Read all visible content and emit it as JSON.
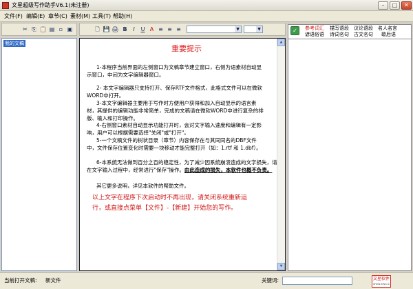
{
  "window": {
    "title": "文星超级写作助手V6.1(未注册)",
    "controls": {
      "minimize": "–",
      "maximize": "□",
      "close": "✕"
    }
  },
  "menu": [
    "文件(F)",
    "编辑(E)",
    "章节(C)",
    "素材(M)",
    "工具(T)",
    "帮助(H)"
  ],
  "icons": {
    "tree_toolbar": [
      "cut-icon",
      "copy-icon",
      "paste-icon",
      "list-icon",
      "page-icon",
      "pages-icon"
    ],
    "editor_toolbar": [
      "new-file-icon",
      "save-icon",
      "print-icon",
      "bold-icon",
      "italic-icon",
      "underline-icon",
      "font-color-icon",
      "align-left-icon",
      "align-center-icon",
      "align-right-icon"
    ],
    "glyphs": [
      "✂",
      "⎘",
      "📋",
      "▤",
      "▫",
      "▣",
      "🗋",
      "💾",
      "🖨",
      "B",
      "I",
      "U",
      "A",
      "≡",
      "≡",
      "≡"
    ]
  },
  "tree": {
    "item": "我的文稿"
  },
  "editor": {
    "title": "重要提示",
    "p1": "1-本程序当前界面的左侧窗口为文稿章节建立窗口，右侧为语素材自动显示窗口，中间为文字编辑器窗口。",
    "p2": "2- 本文字编辑器只支持打开、保存RTF文件格式，此格式文件可以在微软WORD中打开。",
    "p3": "3-本文字编辑器主要用于写作时方便用户获得和加入自动显示的语言素材，其提供的编辑功能非常简单，完成的文稿请在微软WORD中进行复杂的排版、输入和打印操作。",
    "p4": "4-右侧窗口素材自动显示功能打开时，会对文字输入速度和编辑有一定影响，用户可以根据需要选择\"关闭\"或\"打开\"。",
    "p5": "5-一个文稿文件的树状目录（章节）内容保存在与其同同名的DBF文件中，文件保存位置变化时需要一块移动才能完整打开（如：1.rtf 和 1.dbf）。",
    "p6_a": "6-本系统无法做到百分之百的稳定性，为了减少因系统崩溃造成的文字损失，请在文字输入过程中，经常进行\"保存\"操作。",
    "p6_b": "由此造成的损失，本软件也概不负责。",
    "p7": "其它更多说明，详见本软件的帮助文件。",
    "note": "以上文字在程序下次启动时不再出现，请关闭系统重新运行，或直接点菜单【文件】-【新建】开始您的写作。"
  },
  "scrollbar": {
    "up": "▲",
    "down": "▼"
  },
  "categories": {
    "check_icon": "✓",
    "items": [
      {
        "label": "参考词汇",
        "active": true
      },
      {
        "label": "描写语段",
        "active": false
      },
      {
        "label": "议论语段",
        "active": false
      },
      {
        "label": "名人名言",
        "active": false
      },
      {
        "label": "谚语俗语",
        "active": false
      },
      {
        "label": "诗词名句",
        "active": false
      },
      {
        "label": "古文名句",
        "active": false
      },
      {
        "label": "歇后语",
        "active": false
      }
    ]
  },
  "status": {
    "current_doc_label": "当前打开文稿:",
    "current_doc_value": "新文件",
    "keyword_label": "关键词:",
    "keyword_value": "",
    "logo_text": "文星软件",
    "logo_sub": "WWW.XING.Software"
  },
  "colors": {
    "accent_red": "#e02020",
    "selection_blue": "#316ac5",
    "panel_border": "#7a96c0"
  }
}
